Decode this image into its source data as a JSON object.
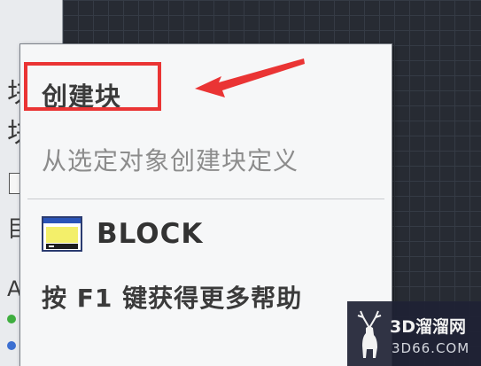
{
  "tooltip": {
    "title": "创建块",
    "description": "从选定对象创建块定义",
    "command": "BLOCK",
    "help_text": "按 F1 键获得更多帮助"
  },
  "palette": {
    "glyphs": [
      "块",
      "块",
      "目",
      "A"
    ]
  },
  "watermark": {
    "brand": "3D溜溜网",
    "domain": "3D66.COM"
  },
  "colors": {
    "highlight": "#ea3434",
    "canvas": "#272b33",
    "tooltip_bg": "#f6f7f8"
  },
  "icons": {
    "command_icon": "window-block-icon",
    "watermark_logo": "deer-icon"
  }
}
